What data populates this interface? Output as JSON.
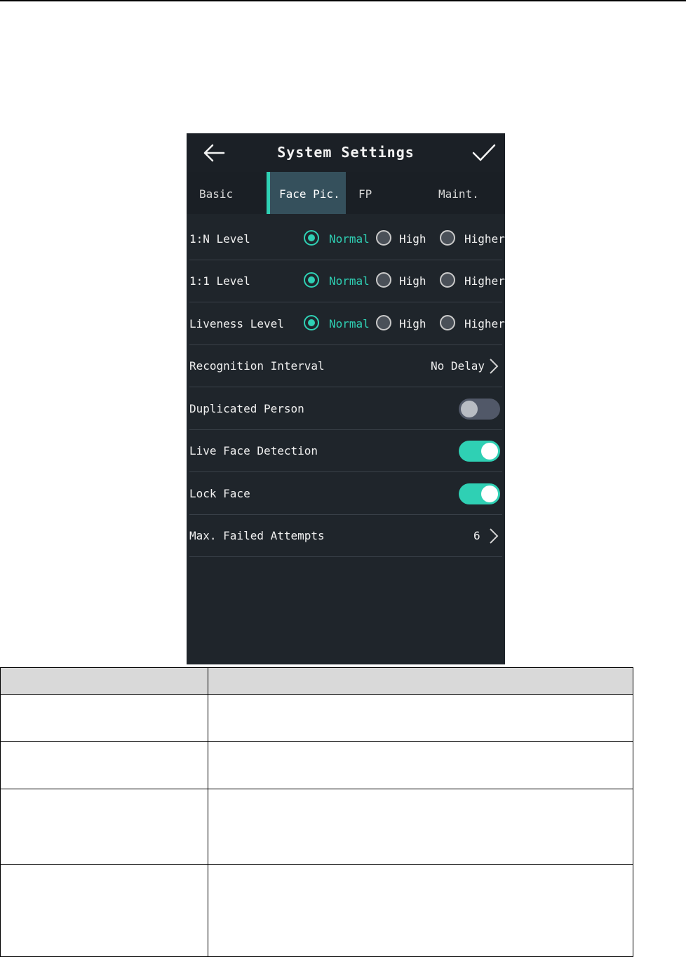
{
  "header": {
    "title": "System Settings",
    "back_icon": "arrow-left-icon",
    "confirm_icon": "checkmark-icon"
  },
  "tabs": [
    {
      "label": "Basic",
      "active": false
    },
    {
      "label": "Face Pic.",
      "active": true
    },
    {
      "label": "FP",
      "active": false
    },
    {
      "label": "Maint.",
      "active": false
    }
  ],
  "levels": {
    "options": [
      "Normal",
      "High",
      "Higher"
    ],
    "rows": [
      {
        "label": "1:N Level",
        "selected": "Normal"
      },
      {
        "label": "1:1 Level",
        "selected": "Normal"
      },
      {
        "label": "Liveness Level",
        "selected": "Normal"
      }
    ]
  },
  "recognition_interval": {
    "label": "Recognition Interval",
    "value": "No Delay"
  },
  "toggles": [
    {
      "label": "Duplicated Person",
      "on": false
    },
    {
      "label": "Live Face Detection",
      "on": true
    },
    {
      "label": "Lock Face",
      "on": true
    }
  ],
  "max_failed_attempts": {
    "label": "Max. Failed Attempts",
    "value": "6"
  },
  "colors": {
    "accent": "#2fd0b4",
    "panel_bg": "#1f252b",
    "header_bg": "#1b2026",
    "active_tab_bg": "#35505c",
    "table_header_bg": "#d9d9d9"
  }
}
